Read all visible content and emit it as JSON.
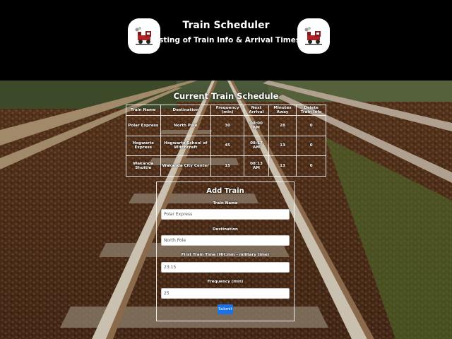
{
  "header": {
    "title": "Train Scheduler",
    "subtitle": "Listing of Train Info & Arrival Times"
  },
  "schedule": {
    "title": "Current Train Schedule",
    "columns": [
      "Train Name",
      "Destination",
      "Frequency (min)",
      "Next Arrival",
      "Minutes Away",
      "Delete Train Info"
    ],
    "rows": [
      [
        "Polar Express",
        "North Pole",
        "30",
        "08:00 AM",
        "28",
        "0"
      ],
      [
        "Hogwarts Express",
        "Hogwarts School of Witchcraft",
        "45",
        "08:17 AM",
        "13",
        "0"
      ],
      [
        "Wakanda Shuttle",
        "Wakanda City Center",
        "15",
        "08:13 AM",
        "13",
        "0"
      ]
    ]
  },
  "form": {
    "title": "Add Train",
    "fields": [
      {
        "label": "Train Name",
        "value": "Polar Express"
      },
      {
        "label": "Destination",
        "value": "North Pole"
      },
      {
        "label": "First Train Time (HH:mm - military time)",
        "value": "23:15"
      },
      {
        "label": "Frequency (min)",
        "value": "25"
      }
    ],
    "submit_label": "Submit"
  },
  "colors": {
    "header_bg": "#000000",
    "button": "#1a73e8"
  },
  "icons": [
    "train-logo-icon"
  ]
}
